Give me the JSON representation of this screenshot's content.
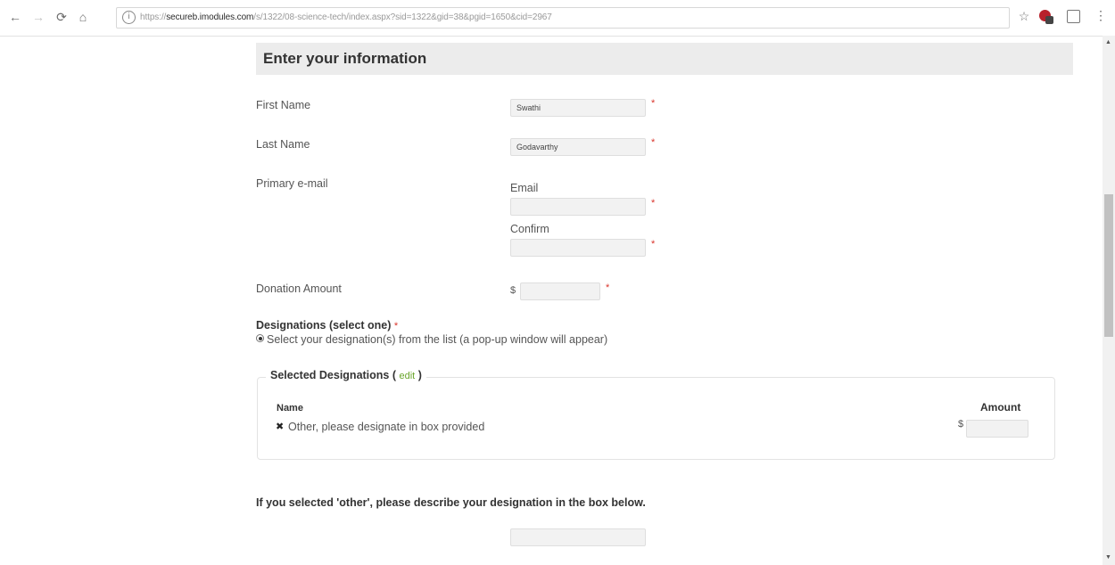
{
  "browser": {
    "url_scheme": "https://",
    "url_host": "secureb.imodules.com",
    "url_path": "/s/1322/08-science-tech/index.aspx?sid=1322&gid=38&pgid=1650&cid=2967"
  },
  "form": {
    "title": "Enter your information",
    "first_name": {
      "label": "First Name",
      "value": "Swathi",
      "required": "*"
    },
    "last_name": {
      "label": "Last Name",
      "value": "Godavarthy",
      "required": "*"
    },
    "email": {
      "label": "Primary e-mail",
      "email_label": "Email",
      "email_value": "",
      "confirm_label": "Confirm",
      "confirm_value": "",
      "required": "*"
    },
    "donation": {
      "label": "Donation Amount",
      "currency": "$",
      "value": "",
      "required": "*"
    },
    "designations": {
      "title": "Designations (select one)",
      "required": "*",
      "option_label": "Select your designation(s) from the list (a pop-up window will appear)",
      "selected_legend": "Selected Designations (",
      "edit_link": "edit",
      "legend_close": ")",
      "col_name": "Name",
      "col_amount": "Amount",
      "rows": [
        {
          "remove": "✖",
          "name": "Other, please designate in box provided",
          "currency": "$",
          "amount": ""
        }
      ]
    },
    "other_prompt": "If you selected 'other', please describe your designation in the box below.",
    "other_value": ""
  }
}
